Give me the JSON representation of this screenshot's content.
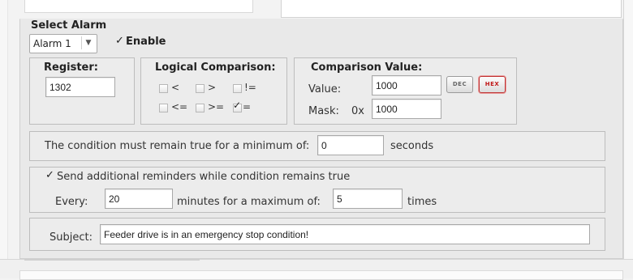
{
  "select_alarm": {
    "title": "Select Alarm",
    "dropdown_value": "Alarm 1",
    "enable_label": "Enable",
    "enable_checked": true
  },
  "register": {
    "label": "Register:",
    "value": "1302"
  },
  "logical_comparison": {
    "label": "Logical Comparison:",
    "options": [
      {
        "label": "<",
        "checked": false
      },
      {
        "label": ">",
        "checked": false
      },
      {
        "label": "!=",
        "checked": false
      },
      {
        "label": "<=",
        "checked": false
      },
      {
        "label": ">=",
        "checked": false
      },
      {
        "label": "=",
        "checked": true
      }
    ]
  },
  "comparison_value": {
    "label": "Comparison Value:",
    "value_label": "Value:",
    "value": "1000",
    "dec_button": "DEC",
    "hex_button": "HEX",
    "mask_label": "Mask:",
    "mask_prefix": "0x",
    "mask_value": "1000"
  },
  "condition": {
    "prefix": "The condition must remain true for a minimum of:",
    "value": "0",
    "suffix": "seconds"
  },
  "reminders": {
    "label": "Send additional reminders while condition remains true",
    "checked": true,
    "every_label": "Every:",
    "every_value": "20",
    "minutes_label": "minutes for a maximum of:",
    "max_value": "5",
    "times_label": "times"
  },
  "subject": {
    "label": "Subject:",
    "value": "Feeder drive is in an emergency stop condition!"
  },
  "icons": {
    "dropdown": "chevron-down-icon",
    "check": "checkmark-icon"
  },
  "colors": {
    "panel_bg": "#e9e9e9",
    "group_border": "#bdbdbd",
    "hex_accent": "#c01818"
  }
}
